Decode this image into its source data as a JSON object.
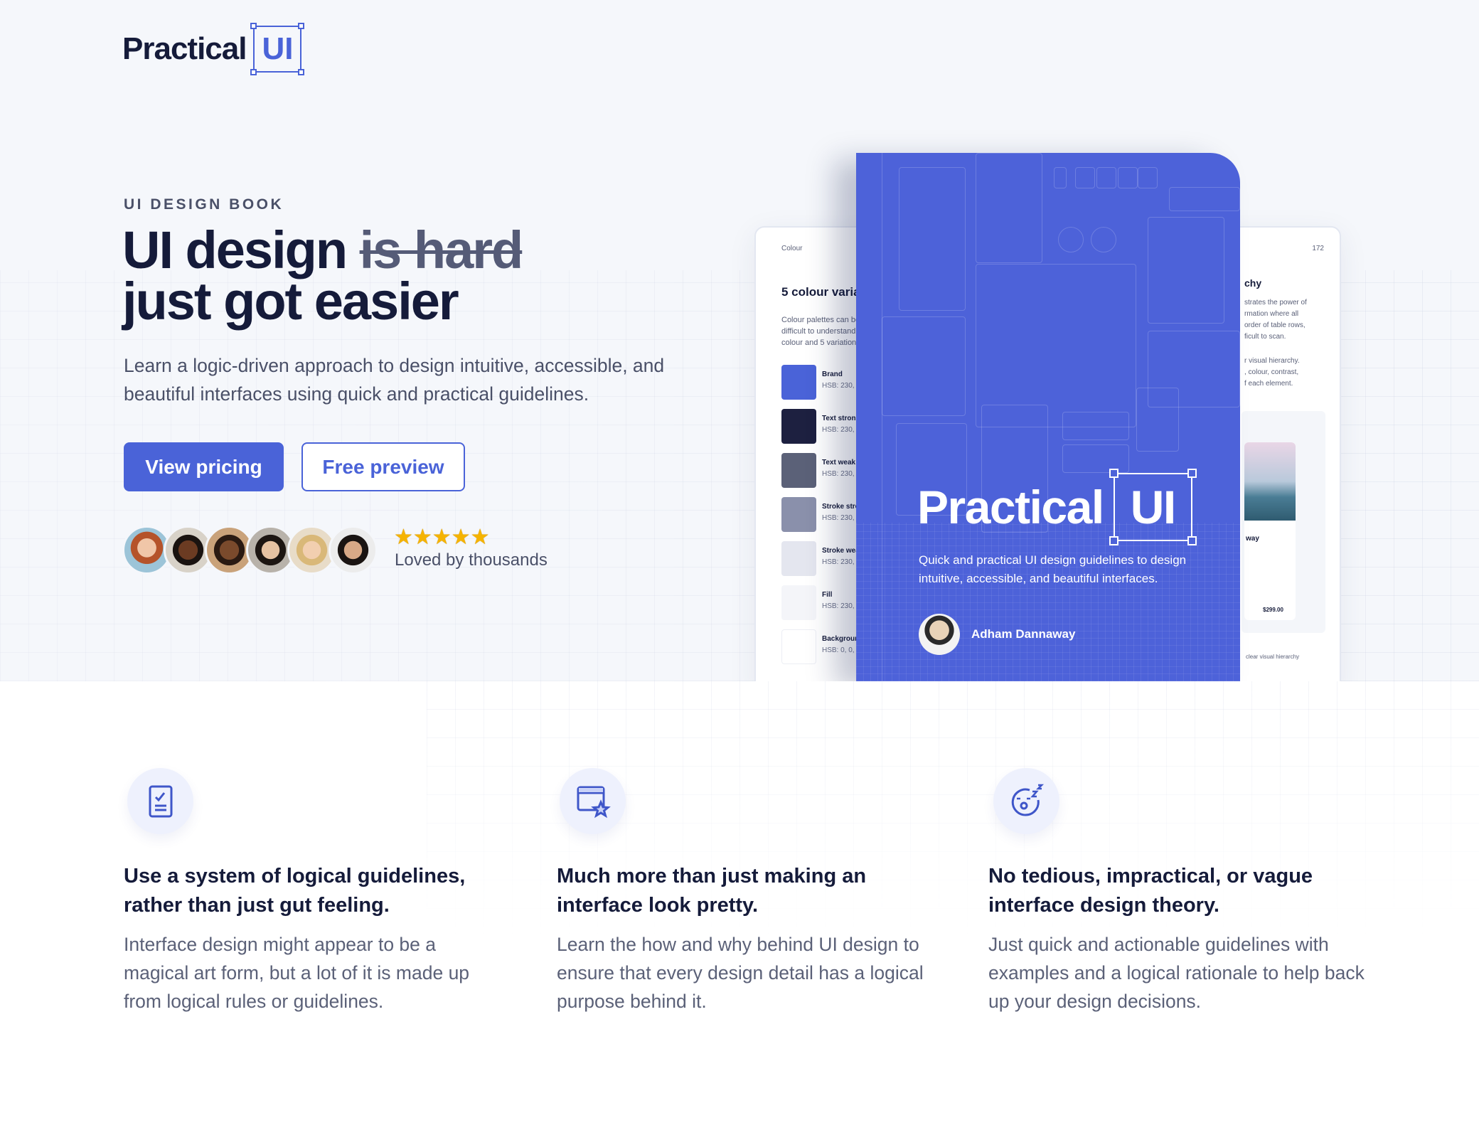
{
  "brand": {
    "logo_word": "Practical",
    "logo_mark": "UI",
    "accent": "#4a63d8",
    "text_dark": "#151b3a"
  },
  "hero": {
    "eyebrow": "UI DESIGN BOOK",
    "title_line1_start": "UI design ",
    "title_strike": "is hard",
    "title_line2": "just got easier",
    "lead": "Learn a logic-driven approach to design intuitive, accessible, and beautiful interfaces using quick and practical guidelines.",
    "primary_button": "View pricing",
    "secondary_button": "Free preview",
    "rating_stars": 5,
    "stars": "★★★★★",
    "social_proof": "Loved by thousands"
  },
  "book": {
    "cover_title_word": "Practical",
    "cover_title_mark": "UI",
    "cover_subtitle": "Quick and practical UI design guidelines to design intuitive, accessible, and beautiful interfaces.",
    "author": "Adham Dannaway",
    "left_page": {
      "section": "Colour",
      "heading": "5 colour varia",
      "body": [
        "Colour palettes can be c",
        "difficult to understand a",
        "colour and 5 variations"
      ],
      "swatches": [
        {
          "name": "Brand",
          "value": "HSB: 230, (",
          "color": "#4a63d8"
        },
        {
          "name": "Text strong",
          "value": "HSB: 230, !",
          "color": "#1d2040"
        },
        {
          "name": "Text weak",
          "value": "HSB: 230, :",
          "color": "#5b6178"
        },
        {
          "name": "Stroke stron",
          "value": "HSB: 230, :",
          "color": "#8a90ab"
        },
        {
          "name": "Stroke weal",
          "value": "HSB: 230, !",
          "color": "#e4e6ef"
        },
        {
          "name": "Fill",
          "value": "HSB: 230, :",
          "color": "#f4f5f9"
        },
        {
          "name": "Backgroun",
          "value": "HSB: 0, 0, 1",
          "color": "#ffffff"
        }
      ]
    },
    "right_page": {
      "page_number": "172",
      "heading": "chy",
      "body1": [
        "strates the power of",
        "rmation where all",
        "order of table rows,",
        "ficult to scan."
      ],
      "body2": [
        "r visual hierarchy.",
        ", colour, contrast,",
        "f each element."
      ],
      "card_title": "way",
      "card_price": "$299.00",
      "caption": "clear visual hierarchy"
    }
  },
  "features": [
    {
      "icon": "checklist-document-icon",
      "title": "Use a system of logical guidelines, rather than just gut feeling.",
      "description": "Interface design might appear to be a magical art form, but a lot of it is made up from logical rules or guidelines."
    },
    {
      "icon": "window-star-icon",
      "title": "Much more than just making an interface look pretty.",
      "description": "Learn the how and why behind UI design to ensure that every design detail has a logical purpose behind it."
    },
    {
      "icon": "sleepy-face-icon",
      "title": "No tedious, impractical, or vague interface design theory.",
      "description": "Just quick and actionable guidelines with examples and a logical rationale to help back up your design decisions."
    }
  ]
}
